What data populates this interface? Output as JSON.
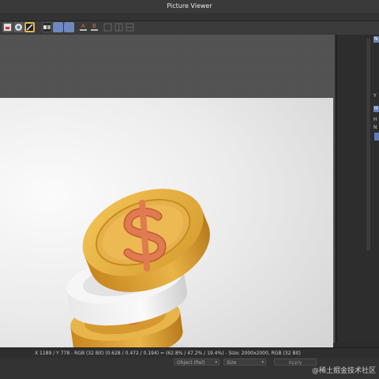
{
  "window": {
    "title": "Picture Viewer"
  },
  "status": {
    "info": "X 1189 / Y 778 - RGB (32 Bit) (0.628 / 0.472 / 0.194) = (62.8% / 47.2% / 19.4%) - Size: 2000x2000, RGB (32 Bit)"
  },
  "bottom": {
    "object_dropdown": "Object (Rel)",
    "size_dropdown": "Size",
    "apply_button": "Apply"
  },
  "right_panel": {
    "tab_top": "N",
    "tab_mid": "H",
    "label_n": "N",
    "label_y": "Y",
    "label_h": "H"
  },
  "watermark": "@稀土掘金技术社区",
  "colors": {
    "toolbar_highlight": "#6f88bf",
    "coin_gold": "#e0a83a",
    "coin_symbol": "#d9714a",
    "coin_white": "#f2f2f2"
  },
  "icons": [
    "image-icon",
    "layers-icon",
    "compare-icon",
    "color-picker-icon",
    "ab-compare-icon",
    "channel-a-icon",
    "channel-b-icon",
    "grid-view-icon"
  ]
}
